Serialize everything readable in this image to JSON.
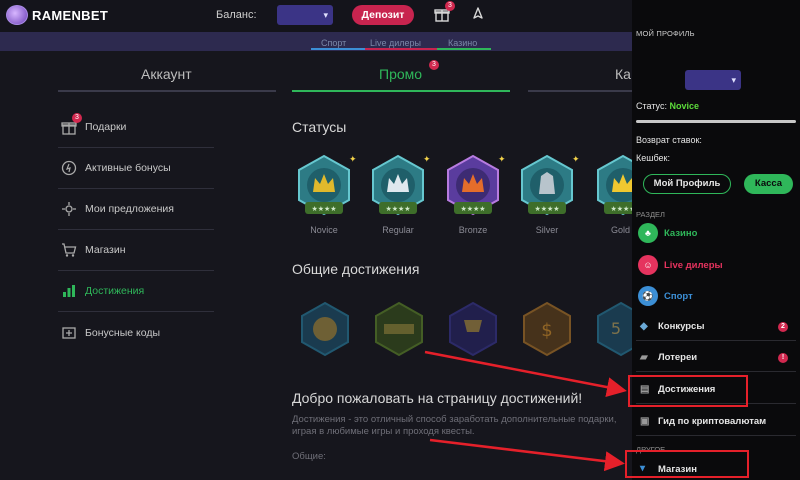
{
  "header": {
    "brand": "RAMENBET",
    "balance_label": "Баланс:",
    "balance_chevron": "▾",
    "deposit": "Депозит",
    "gift_badge": "3"
  },
  "strip": {
    "tabs": [
      "Спорт",
      "Live дилеры",
      "Казино"
    ]
  },
  "tabs": [
    {
      "label": "Аккаунт",
      "active": false
    },
    {
      "label": "Промо",
      "active": true,
      "badge": "3"
    },
    {
      "label": "Ка",
      "active": false
    }
  ],
  "sidebar": {
    "items": [
      {
        "label": "Подарки",
        "icon": "gift-icon",
        "badge": "3"
      },
      {
        "label": "Активные бонусы",
        "icon": "bonus-icon"
      },
      {
        "label": "Мои предложения",
        "icon": "offers-icon"
      },
      {
        "label": "Магазин",
        "icon": "cart-icon"
      },
      {
        "label": "Достижения",
        "icon": "chart-icon",
        "active": true
      },
      {
        "label": "Бонусные коды",
        "icon": "code-icon"
      }
    ]
  },
  "main": {
    "statuses_heading": "Статусы",
    "statuses": [
      {
        "name": "Novice",
        "color": "#e0b92c"
      },
      {
        "name": "Regular",
        "color": "#dfe8ee"
      },
      {
        "name": "Bronze",
        "color": "#e46d2b"
      },
      {
        "name": "Silver",
        "color": "#b8c4cc"
      },
      {
        "name": "Gold",
        "color": "#f0c830"
      }
    ],
    "achievements_heading": "Общие достижения",
    "achievements": [
      {
        "icon": "coin-achievement-icon",
        "color": "#2a8fb5"
      },
      {
        "icon": "winner-achievement-icon",
        "color": "#6a9a2c"
      },
      {
        "icon": "winner-trophy-achievement-icon",
        "color": "#3f3ca6"
      },
      {
        "icon": "stack-achievement-icon",
        "color": "#c8862a"
      },
      {
        "icon": "contest-achievement-icon",
        "color": "#2a8fb5"
      }
    ],
    "welcome": "Добро пожаловать на страницу достижений!",
    "description": "Достижения - это отличный способ заработать дополнительные подарки, играя в любимые игры и проходя квесты.",
    "general": "Общие:"
  },
  "panel": {
    "title": "МОЙ ПРОФИЛЬ",
    "select_chevron": "▾",
    "status_label": "Статус:",
    "status_value": "Novice",
    "refund": "Возврат ставок:",
    "cashback": "Кешбек:",
    "profile_btn": "Мой Профиль",
    "kassa_btn": "Касса",
    "section": "РАЗДЕЛ",
    "casino": "Казино",
    "live": "Live дилеры",
    "sport": "Спорт",
    "contests": "Конкурсы",
    "contests_badge": "2",
    "lotteries": "Лотереи",
    "lotteries_badge": "!",
    "achievements": "Достижения",
    "crypto_guide": "Гид по криптовалютам",
    "other": "ДРУГОЕ",
    "shop": "Магазин"
  },
  "colors": {
    "accent": "#2fb75a",
    "danger": "#d2284f",
    "purple": "#3b3486",
    "annotation": "#e5202a"
  }
}
